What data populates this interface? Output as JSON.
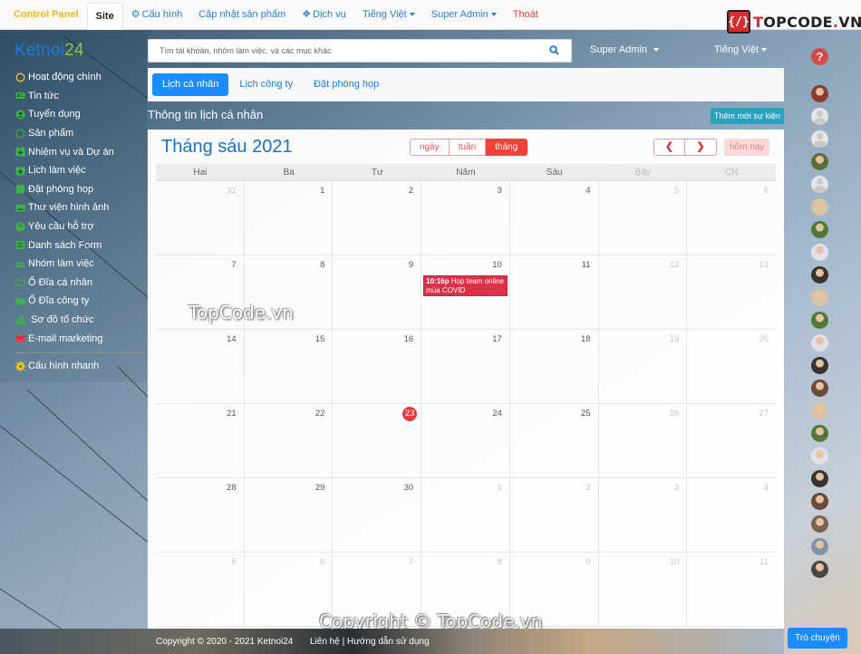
{
  "topnav": {
    "brand": "Control Panel",
    "items": [
      {
        "label": "Site",
        "active": true
      },
      {
        "label": "Cấu hình",
        "icon": "gears-icon"
      },
      {
        "label": "Cập nhật sản phẩm"
      },
      {
        "label": "Dịch vụ",
        "icon": "cubes-icon"
      },
      {
        "label": "Tiếng Việt",
        "dropdown": true
      },
      {
        "label": "Super Admin",
        "dropdown": true
      }
    ],
    "logout": "Thoát"
  },
  "watermark_logo": {
    "mark": "{/}",
    "text_red": "T",
    "text_dark": "OPCODE",
    "text_suffix_red": ".",
    "text_end": "VN"
  },
  "logo": {
    "part1": "Ketnoi",
    "part2": "24"
  },
  "sidebar": {
    "items": [
      {
        "label": "Hoạt động chính",
        "icon": "circle-icon"
      },
      {
        "label": "Tin tức",
        "icon": "newspaper-icon"
      },
      {
        "label": "Tuyển dụng",
        "icon": "user-circle-icon"
      },
      {
        "label": "Sản phẩm",
        "icon": "circle-outline-icon"
      },
      {
        "label": "Nhiệm vụ và Dự án",
        "icon": "calendar-plus-icon"
      },
      {
        "label": "Lịch làm việc",
        "icon": "calendar-plus-icon"
      },
      {
        "label": "Đặt phòng họp",
        "icon": "calendar-icon"
      },
      {
        "label": "Thư viện hình ảnh",
        "icon": "image-icon"
      },
      {
        "label": "Yêu cầu hỗ trợ",
        "icon": "question-circle-icon"
      },
      {
        "label": "Danh sách Form",
        "icon": "list-icon"
      },
      {
        "label": "Nhóm làm việc",
        "icon": "users-icon"
      },
      {
        "label": "Ổ Đĩa cá nhân",
        "icon": "folder-outline-icon"
      },
      {
        "label": "Ổ Đĩa công ty",
        "icon": "folder-icon"
      },
      {
        "label": "Sơ đồ tổ chức",
        "icon": "sitemap-icon"
      },
      {
        "label": "E-mail marketing",
        "icon": "envelope-icon"
      }
    ],
    "quick_config": {
      "label": "Cấu hình nhanh",
      "icon": "cog-icon"
    }
  },
  "search": {
    "placeholder": "Tìm tài khoản, nhóm làm việc, và các mục khác",
    "value": ""
  },
  "user_menu": "Super Admin",
  "lang_menu": "Tiếng Việt",
  "help": "?",
  "tabs": [
    {
      "label": "Lịch cá nhân",
      "active": true
    },
    {
      "label": "Lịch công ty"
    },
    {
      "label": "Đặt phòng họp"
    }
  ],
  "section_title": "Thông tin lịch cá nhân",
  "add_event_label": "Thêm mới sự kiện",
  "calendar": {
    "title": "Tháng sáu 2021",
    "views": [
      {
        "label": "ngày"
      },
      {
        "label": "tuần"
      },
      {
        "label": "tháng",
        "active": true
      }
    ],
    "prev": "❮",
    "next": "❯",
    "today_label": "hôm nay",
    "days_of_week": [
      "Hai",
      "Ba",
      "Tư",
      "Năm",
      "Sáu",
      "Bảy",
      "CN"
    ],
    "weeks": [
      [
        "31",
        "1",
        "2",
        "3",
        "4",
        "5",
        "6"
      ],
      [
        "7",
        "8",
        "9",
        "10",
        "11",
        "12",
        "13"
      ],
      [
        "14",
        "15",
        "16",
        "17",
        "18",
        "19",
        "20"
      ],
      [
        "21",
        "22",
        "23",
        "24",
        "25",
        "26",
        "27"
      ],
      [
        "28",
        "29",
        "30",
        "1",
        "2",
        "3",
        "4"
      ],
      [
        "5",
        "6",
        "7",
        "8",
        "9",
        "10",
        "11"
      ]
    ],
    "today": "23",
    "events": [
      {
        "week": 1,
        "day": 3,
        "time": "10:16p",
        "title": "Họp team online mùa COVID"
      }
    ]
  },
  "watermarks": {
    "center": "TopCode.vn",
    "bottom": "Copyright © TopCode.vn"
  },
  "footer": {
    "copyright": "Copyright © 2020 - 2021 Ketnoi24",
    "contact": "Liên hệ",
    "separator": "|",
    "guide": "Hướng dẫn sử dụng"
  },
  "online_users_count": 22,
  "chat_button": "Trò chuyện",
  "colors": {
    "brand_yellow": "#f0b61d",
    "link_blue": "#2f7ec7",
    "primary": "#1a8cff",
    "danger": "#ef4238",
    "event": "#d93148",
    "info": "#27a3bd",
    "title_blue": "#1e74b8"
  }
}
